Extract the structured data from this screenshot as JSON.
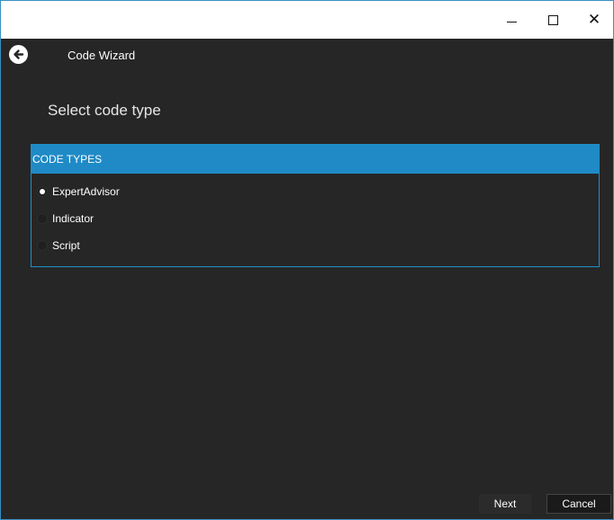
{
  "window": {
    "controls": {
      "minimize_icon": "minimize-icon",
      "maximize_icon": "maximize-icon",
      "close_icon": "close-icon",
      "close_glyph": "✕"
    }
  },
  "header": {
    "title": "Code Wizard",
    "back_icon": "back-arrow-icon"
  },
  "page": {
    "heading": "Select code type"
  },
  "code_types": {
    "header": "CODE TYPES",
    "selected": "ExpertAdvisor",
    "options": [
      {
        "label": "ExpertAdvisor",
        "checked": true
      },
      {
        "label": "Indicator",
        "checked": false
      },
      {
        "label": "Script",
        "checked": false
      }
    ]
  },
  "footer": {
    "next_label": "Next",
    "cancel_label": "Cancel"
  },
  "colors": {
    "background": "#262626",
    "accent": "#1f8ac6",
    "text": "#ffffff",
    "titlebar": "#ffffff"
  }
}
